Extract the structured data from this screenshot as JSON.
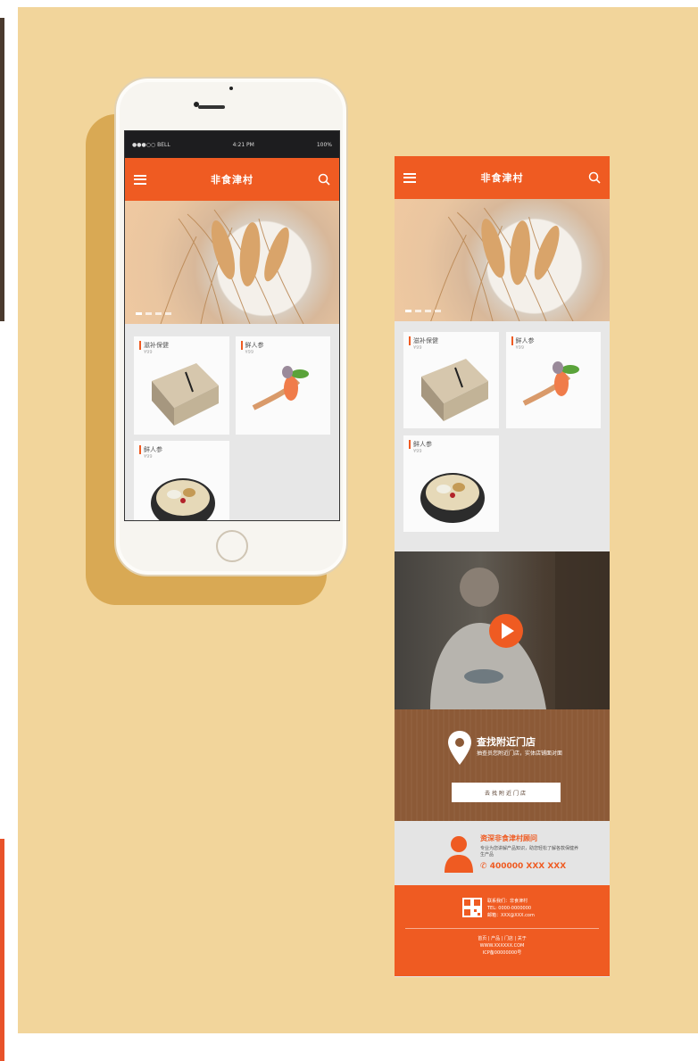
{
  "app": {
    "title": "非食津村"
  },
  "status_bar": {
    "carrier": "●●●○○ BELL",
    "time": "4:21 PM",
    "battery": "100%"
  },
  "products": [
    {
      "name": "滋补保健",
      "price": "¥99"
    },
    {
      "name": "鲜人参",
      "price": "¥99"
    },
    {
      "name": "鲜人参",
      "price": "¥99"
    }
  ],
  "store": {
    "title": "查找附近门店",
    "description": "抽查员您附近门店，实体店铺面对面",
    "button": "去找附近门店"
  },
  "consult": {
    "title": "资深非食津村顾问",
    "description": "专业为您讲解产品知识，助您轻松了解各款保健养生产品",
    "phone": "400000 XXX XXX"
  },
  "footer": {
    "company": "联系我们：非食津村",
    "tel": "TEL: 0000-0000000",
    "mail": "邮箱：XXX@XXX.com",
    "nav": "首页 | 产品 | 门店 | 关于",
    "web": "WWW.XXXXXX.COM",
    "icp": "ICP备00000000号"
  },
  "colors": {
    "accent": "#ef5b22",
    "poster_bg": "#f2d59b",
    "store_bg": "#8c5a37"
  },
  "icons": [
    "menu-icon",
    "search-icon",
    "play-icon",
    "location-pin-icon",
    "consultant-icon",
    "phone-icon",
    "qr-code-icon"
  ]
}
